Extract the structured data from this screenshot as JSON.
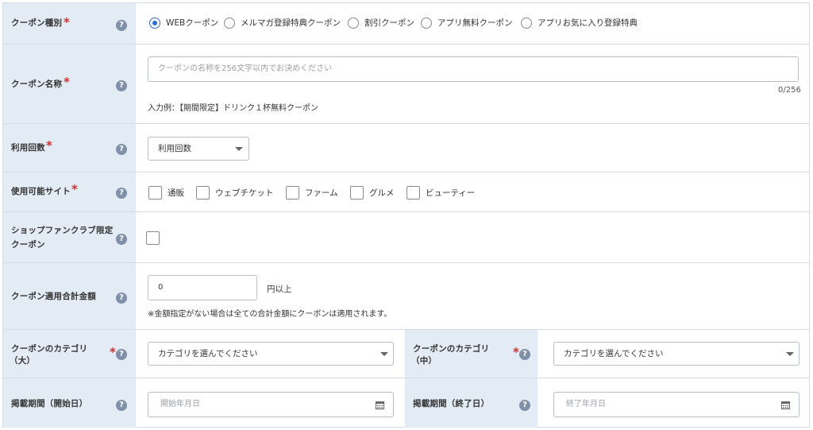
{
  "coupon_type": {
    "label": "クーポン種別",
    "options": [
      {
        "label": "WEBクーポン",
        "selected": true
      },
      {
        "label": "メルマガ登録特典クーポン",
        "selected": false
      },
      {
        "label": "割引クーポン",
        "selected": false
      },
      {
        "label": "アプリ無料クーポン",
        "selected": false
      },
      {
        "label": "アプリお気に入り登録特典",
        "selected": false
      }
    ]
  },
  "coupon_name": {
    "label": "クーポン名称",
    "placeholder": "クーポンの名称を256文字以内でお決めください",
    "counter": "0/256",
    "example": "入力例：【期間限定】ドリンク１杯無料クーポン"
  },
  "usage_count": {
    "label": "利用回数",
    "selected": "利用回数"
  },
  "sites": {
    "label": "使用可能サイト",
    "options": [
      "通販",
      "ウェブチケット",
      "ファーム",
      "グルメ",
      "ビューティー"
    ]
  },
  "fanclub": {
    "label_line1": "ショップファンクラブ限定",
    "label_line2": "クーポン"
  },
  "min_total": {
    "label": "クーポン適用合計金額",
    "value": "0",
    "unit": "円以上",
    "note": "※金額指定がない場合は全ての合計金額にクーポンは適用されます。"
  },
  "category_large": {
    "label_line1": "クーポンのカテゴリ",
    "label_line2": "（大）",
    "selected": "カテゴリを選んでください"
  },
  "category_mid": {
    "label_line1": "クーポンのカテゴリ",
    "label_line2": "（中）",
    "selected": "カテゴリを選んでください"
  },
  "period_start": {
    "label": "掲載期間（開始日）",
    "placeholder": "開始年月日"
  },
  "period_end": {
    "label": "掲載期間（終了日）",
    "placeholder": "終了年月日"
  },
  "required_mark": "*",
  "help_glyph": "?",
  "colors": {
    "label_bg": "#e3ebf5",
    "required": "#d32f2f",
    "help_icon": "#7f90a8",
    "radio_selected": "#2f6bd8",
    "border": "#d4dbe3"
  }
}
